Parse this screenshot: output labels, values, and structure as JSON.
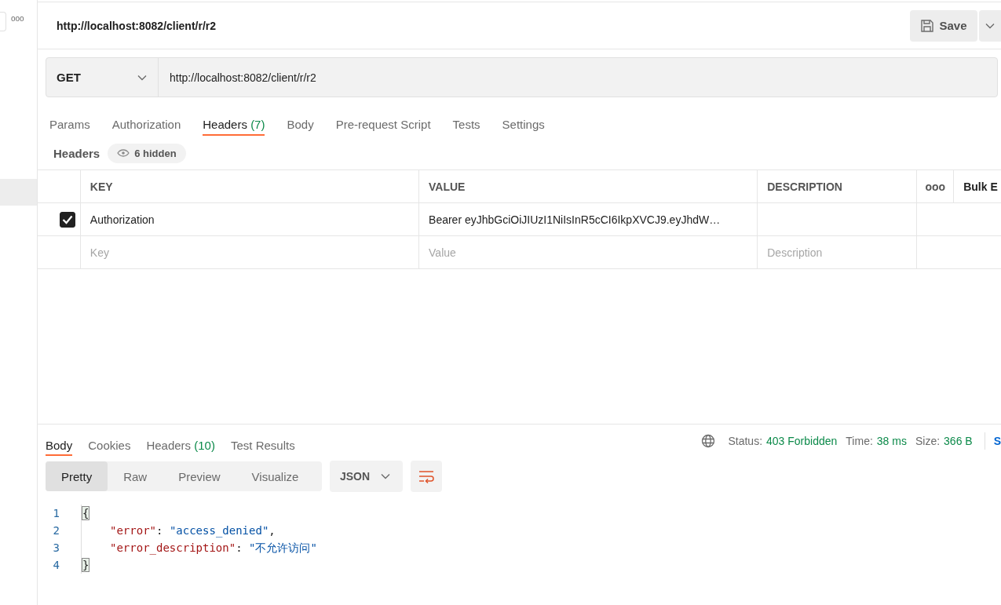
{
  "sidebar": {
    "more": "ooo"
  },
  "request": {
    "title": "http://localhost:8082/client/r/r2",
    "save_label": "Save",
    "method": "GET",
    "url": "http://localhost:8082/client/r/r2"
  },
  "request_tabs": [
    {
      "label": "Params",
      "selected": false
    },
    {
      "label": "Authorization",
      "selected": false
    },
    {
      "label": "Headers",
      "count": "(7)",
      "selected": true
    },
    {
      "label": "Body",
      "selected": false
    },
    {
      "label": "Pre-request Script",
      "selected": false
    },
    {
      "label": "Tests",
      "selected": false
    },
    {
      "label": "Settings",
      "selected": false
    }
  ],
  "headers_bar": {
    "title": "Headers",
    "hidden": "6 hidden"
  },
  "headers_table": {
    "columns": [
      "KEY",
      "VALUE",
      "DESCRIPTION"
    ],
    "more": "ooo",
    "bulk_edit": "Bulk E",
    "rows": [
      {
        "checked": true,
        "key": "Authorization",
        "value": "Bearer  eyJhbGciOiJIUzI1NiIsInR5cCI6IkpXVCJ9.eyJhdW…"
      }
    ],
    "new_row": {
      "key": {
        "placeholder": "Key"
      },
      "value": {
        "placeholder": "Value"
      },
      "description": {
        "placeholder": "Description"
      }
    }
  },
  "response_tabs": [
    {
      "label": "Body",
      "selected": true
    },
    {
      "label": "Cookies",
      "selected": false
    },
    {
      "label": "Headers",
      "count": "(10)",
      "selected": false
    },
    {
      "label": "Test Results",
      "selected": false
    }
  ],
  "response_meta": [
    {
      "label": "Status:",
      "value": "403 Forbidden"
    },
    {
      "label": "Time:",
      "value": "38 ms"
    },
    {
      "label": "Size:",
      "value": "366 B"
    }
  ],
  "save_response": "S",
  "view_modes": [
    {
      "label": "Pretty",
      "selected": true
    },
    {
      "label": "Raw",
      "selected": false
    },
    {
      "label": "Preview",
      "selected": false
    },
    {
      "label": "Visualize",
      "selected": false
    }
  ],
  "format": "JSON",
  "code_lines": [
    {
      "number": "1",
      "tokens": [
        {
          "kind": "bracket",
          "text": "{"
        }
      ]
    },
    {
      "number": "2",
      "tokens": [
        {
          "kind": "key",
          "text": "\"error\""
        },
        {
          "kind": "punct",
          "text": ": "
        },
        {
          "kind": "string",
          "text": "\"access_denied\""
        },
        {
          "kind": "punct",
          "text": ","
        }
      ]
    },
    {
      "number": "3",
      "tokens": [
        {
          "kind": "key",
          "text": "\"error_description\""
        },
        {
          "kind": "punct",
          "text": ": "
        },
        {
          "kind": "string",
          "text": "\"不允许访问\""
        }
      ]
    },
    {
      "number": "4",
      "tokens": [
        {
          "kind": "bracket",
          "text": "}"
        }
      ]
    }
  ]
}
